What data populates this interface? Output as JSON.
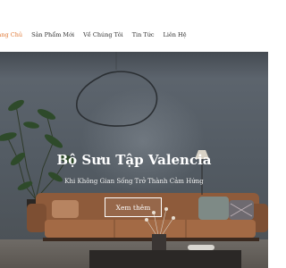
{
  "nav": {
    "items": [
      {
        "label": "Trang Chủ",
        "active": true
      },
      {
        "label": "Sản Phẩm Mới",
        "active": false
      },
      {
        "label": "Về Chúng Tôi",
        "active": false
      },
      {
        "label": "Tin Tức",
        "active": false
      },
      {
        "label": "Liên Hệ",
        "active": false
      }
    ]
  },
  "hero": {
    "title": "Bộ Sưu Tập Valencia",
    "subtitle": "Khi Không Gian Sống Trở Thành Cảm Hứng",
    "cta_label": "Xem thêm"
  },
  "colors": {
    "accent": "#e07b39",
    "nav_text": "#333333",
    "hero_wall": "#5a6168",
    "sofa": "#a36a45"
  }
}
